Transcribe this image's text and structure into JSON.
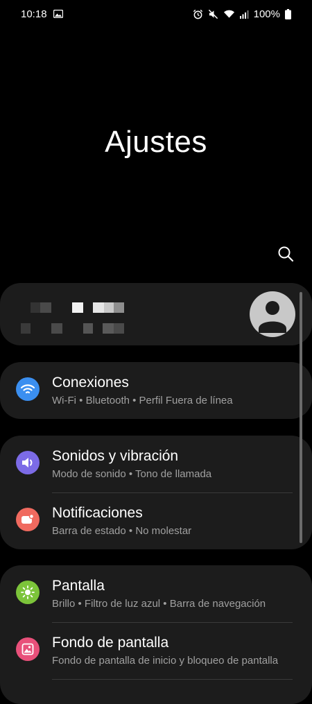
{
  "status": {
    "time": "10:18",
    "battery": "100%",
    "icons": [
      "image-icon",
      "alarm-icon",
      "mute-icon",
      "wifi-icon",
      "signal-icon",
      "battery-icon"
    ]
  },
  "title": "Ajustes",
  "search": {
    "icon": "search-icon"
  },
  "profile": {
    "avatar_icon": "person-icon"
  },
  "menu": [
    {
      "title": "Conexiones",
      "subtitle": "Wi-Fi  •  Bluetooth  •  Perfil Fuera de línea",
      "icon": "wifi-icon",
      "color": "#3b8ff0"
    },
    {
      "title": "Sonidos y vibración",
      "subtitle": "Modo de sonido  •  Tono de llamada",
      "icon": "speaker-icon",
      "color": "#7c6be6"
    },
    {
      "title": "Notificaciones",
      "subtitle": "Barra de estado  •  No molestar",
      "icon": "notification-icon",
      "color": "#f06a5f"
    },
    {
      "title": "Pantalla",
      "subtitle": "Brillo  •  Filtro de luz azul  •  Barra de navegación",
      "icon": "brightness-icon",
      "color": "#7cc43a"
    },
    {
      "title": "Fondo de pantalla",
      "subtitle": "Fondo de pantalla de inicio y bloqueo de pantalla",
      "icon": "wallpaper-icon",
      "color": "#e8507a"
    }
  ]
}
